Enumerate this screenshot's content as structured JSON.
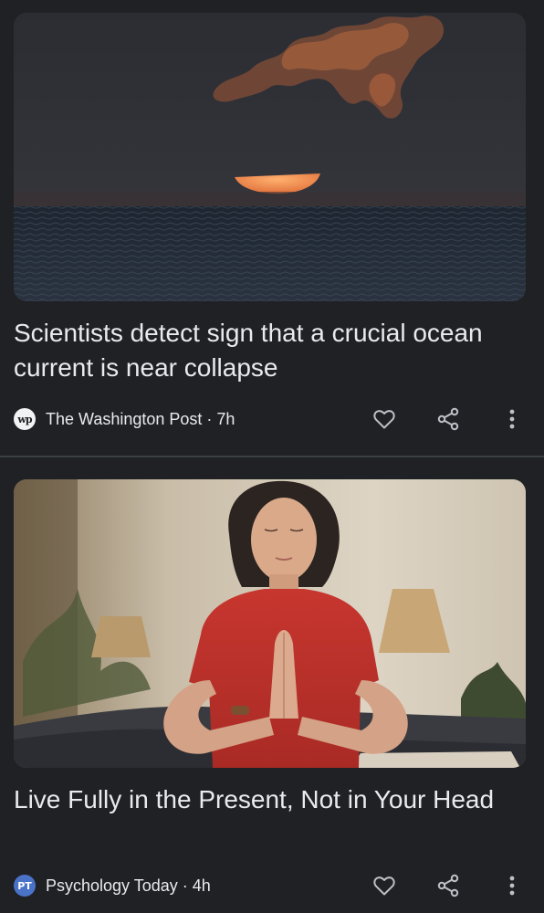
{
  "articles": [
    {
      "headline": "Scientists detect sign that a crucial ocean current is near collapse",
      "source": "The Washington Post",
      "age": "7h",
      "source_logo_text": "wp",
      "image_subject": "sunset over the ocean",
      "logo_color": "#f1f3f4"
    },
    {
      "headline": "Live Fully in the Present, Not in Your Head",
      "source": "Psychology Today",
      "age": "4h",
      "source_logo_text": "PT",
      "image_subject": "woman meditating in red t-shirt",
      "logo_color": "#4a72c7"
    }
  ],
  "meta_separator": " · ",
  "icons": {
    "like": "heart-icon",
    "share": "share-icon",
    "more": "more-vert-icon"
  },
  "colors": {
    "background": "#202124",
    "text": "#e8eaed",
    "icon": "#bdc1c6",
    "divider": "#3c4043"
  }
}
